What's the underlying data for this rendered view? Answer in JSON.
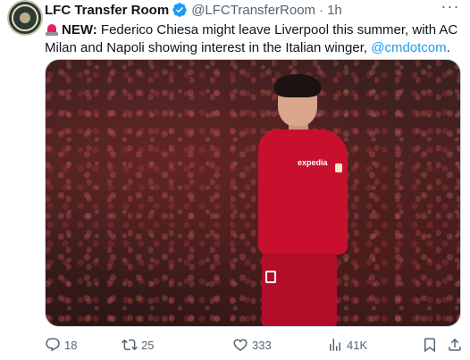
{
  "author": {
    "name": "LFC Transfer Room",
    "handle": "@LFCTransferRoom",
    "separator": "·",
    "time": "1h"
  },
  "tweet": {
    "new_label": "NEW:",
    "body": " Federico Chiesa might leave Liverpool this summer, with AC Milan and Napoli showing interest in the Italian winger, ",
    "mention": "@cmdotcom",
    "end": "."
  },
  "media": {
    "shirt_sponsor": "expedia"
  },
  "actions": {
    "replies": "18",
    "retweets": "25",
    "likes": "333",
    "views": "41K"
  },
  "colors": {
    "accent": "#1d9bf0",
    "muted": "#536471",
    "text": "#0f1419"
  }
}
